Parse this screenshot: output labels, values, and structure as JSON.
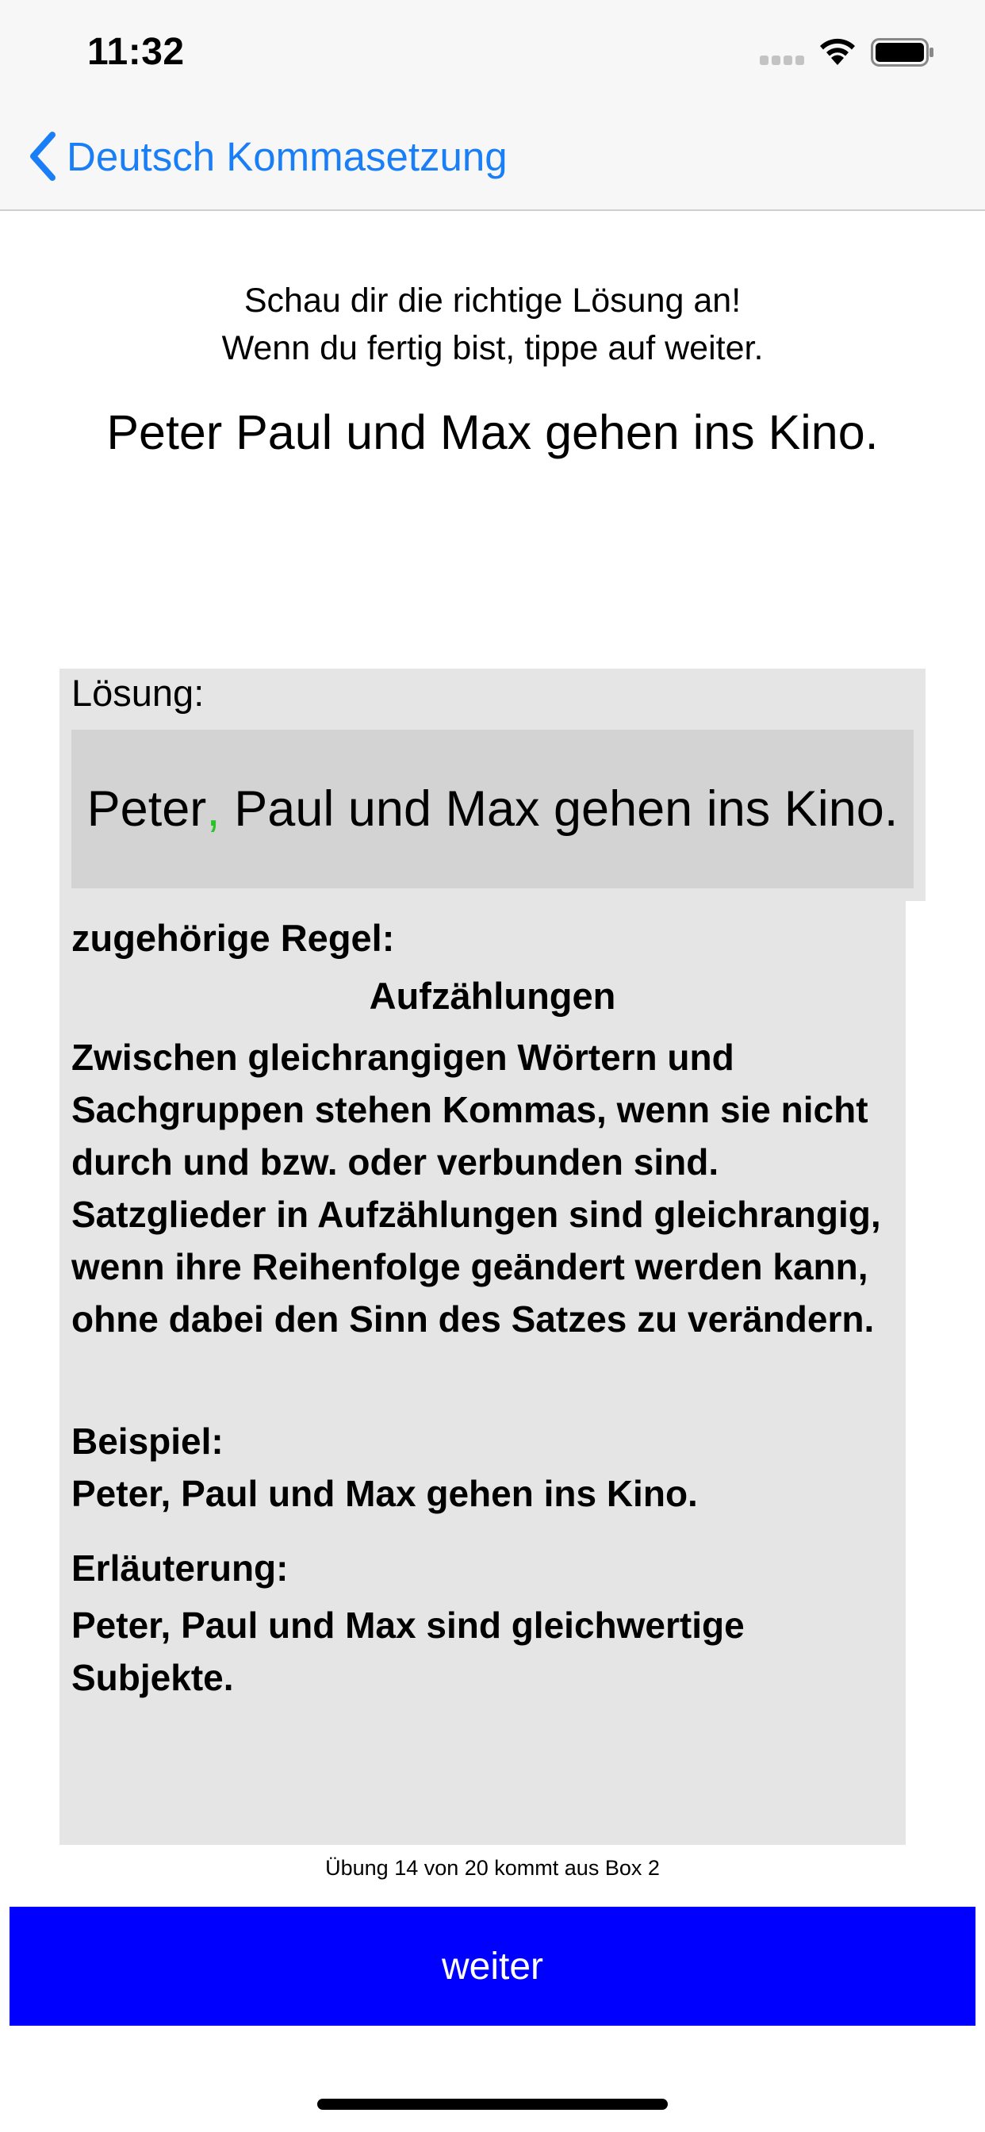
{
  "status_bar": {
    "time": "11:32",
    "icons": [
      "cellular-signal-icon",
      "wifi-icon",
      "battery-icon"
    ]
  },
  "nav": {
    "back_label": "Deutsch Kommasetzung",
    "back_icon": "chevron-left-icon",
    "accent_color": "#1a7ff6"
  },
  "instructions": {
    "line1": "Schau dir die richtige Lösung an!",
    "line2": "Wenn du fertig bist, tippe auf weiter."
  },
  "question": "Peter Paul und Max gehen ins Kino.",
  "solution": {
    "label": "Lösung:",
    "text_before": "Peter",
    "inserted_comma": ",",
    "text_after": " Paul und Max gehen ins Kino.",
    "comma_color": "#29c329"
  },
  "rule": {
    "heading": "zugehörige Regel:",
    "title": "Aufzählungen",
    "text": "Zwischen gleichrangigen Wörtern und Sachgruppen stehen Kommas, wenn sie nicht durch und bzw. oder verbunden sind. Satzglieder in Aufzählungen sind gleichrangig, wenn ihre Reihenfolge geändert werden kann, ohne dabei den Sinn des Satzes zu verändern.",
    "example_heading": "Beispiel:",
    "example_text": "Peter, Paul und Max gehen ins Kino.",
    "explanation_heading": "Erläuterung:",
    "explanation_text": "Peter, Paul und Max sind gleichwertige Subjekte."
  },
  "progress": "Übung 14 von 20 kommt aus Box 2",
  "next_button": {
    "label": "weiter",
    "color": "#0000ff"
  }
}
